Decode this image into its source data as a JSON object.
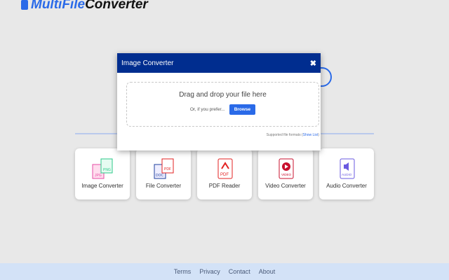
{
  "logo": {
    "part1": "MultiFile",
    "part2": "Converter"
  },
  "modal": {
    "title": "Image Converter",
    "close": "✖",
    "drop_text": "Drag and drop your file here",
    "prefer_text": "Or, if you prefer...",
    "browse": "Browse",
    "supported": "Supported file formats (",
    "show_list": "Show List",
    "supported_end": ")"
  },
  "cards": [
    {
      "label": "Image Converter",
      "color": "#e64ca4"
    },
    {
      "label": "File Converter",
      "color": "#1e3f9e"
    },
    {
      "label": "PDF Reader",
      "color": "#e32222"
    },
    {
      "label": "Video Converter",
      "color": "#c8102e"
    },
    {
      "label": "Audio Converter",
      "color": "#6a5ae0"
    }
  ],
  "footer": [
    "Terms",
    "Privacy",
    "Contact",
    "About"
  ]
}
